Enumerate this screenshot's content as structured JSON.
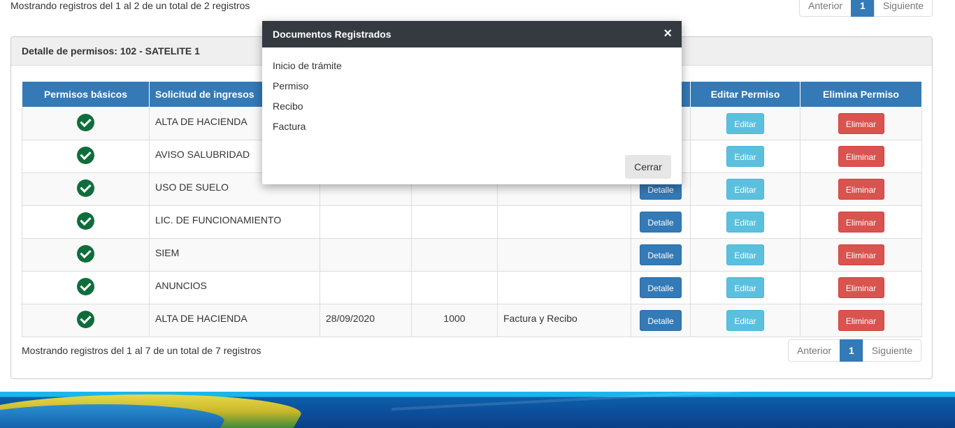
{
  "top": {
    "info": "Mostrando registros del 1 al 2 de un total de 2 registros",
    "pager": {
      "prev": "Anterior",
      "page": "1",
      "next": "Siguiente"
    }
  },
  "panel": {
    "heading": "Detalle de permisos: 102 - SATELITE 1"
  },
  "table": {
    "headers": [
      "Permisos básicos",
      "Solicitud de ingresos",
      "",
      "",
      "",
      "",
      "Editar Permiso",
      "Elimina Permiso"
    ],
    "buttons": {
      "detalle": "Detalle",
      "editar": "Editar",
      "eliminar": "Eliminar"
    },
    "rows": [
      {
        "status": "check-icon",
        "solicitud": "ALTA DE HACIENDA",
        "fecha": "",
        "monto": "",
        "documentos": ""
      },
      {
        "status": "check-icon",
        "solicitud": "AVISO SALUBRIDAD",
        "fecha": "",
        "monto": "",
        "documentos": ""
      },
      {
        "status": "check-icon",
        "solicitud": "USO DE SUELO",
        "fecha": "",
        "monto": "",
        "documentos": ""
      },
      {
        "status": "check-icon",
        "solicitud": "LIC. DE FUNCIONAMIENTO",
        "fecha": "",
        "monto": "",
        "documentos": ""
      },
      {
        "status": "check-icon",
        "solicitud": "SIEM",
        "fecha": "",
        "monto": "",
        "documentos": ""
      },
      {
        "status": "check-icon",
        "solicitud": "ANUNCIOS",
        "fecha": "",
        "monto": "",
        "documentos": ""
      },
      {
        "status": "check-icon",
        "solicitud": "ALTA DE HACIENDA",
        "fecha": "28/09/2020",
        "monto": "1000",
        "documentos": "Factura y Recibo"
      }
    ]
  },
  "bottom": {
    "info": "Mostrando registros del 1 al 7 de un total de 7 registros",
    "pager": {
      "prev": "Anterior",
      "page": "1",
      "next": "Siguiente"
    }
  },
  "modal": {
    "title": "Documentos Registrados",
    "close_icon": "×",
    "items": [
      "Inicio de trámite",
      "Permiso",
      "Recibo",
      "Factura"
    ],
    "close_button": "Cerrar"
  },
  "colors": {
    "primary": "#337ab7",
    "info": "#5bc0de",
    "danger": "#d9534f",
    "success_icon": "#0e6e3b",
    "modal_header": "#343a40"
  }
}
